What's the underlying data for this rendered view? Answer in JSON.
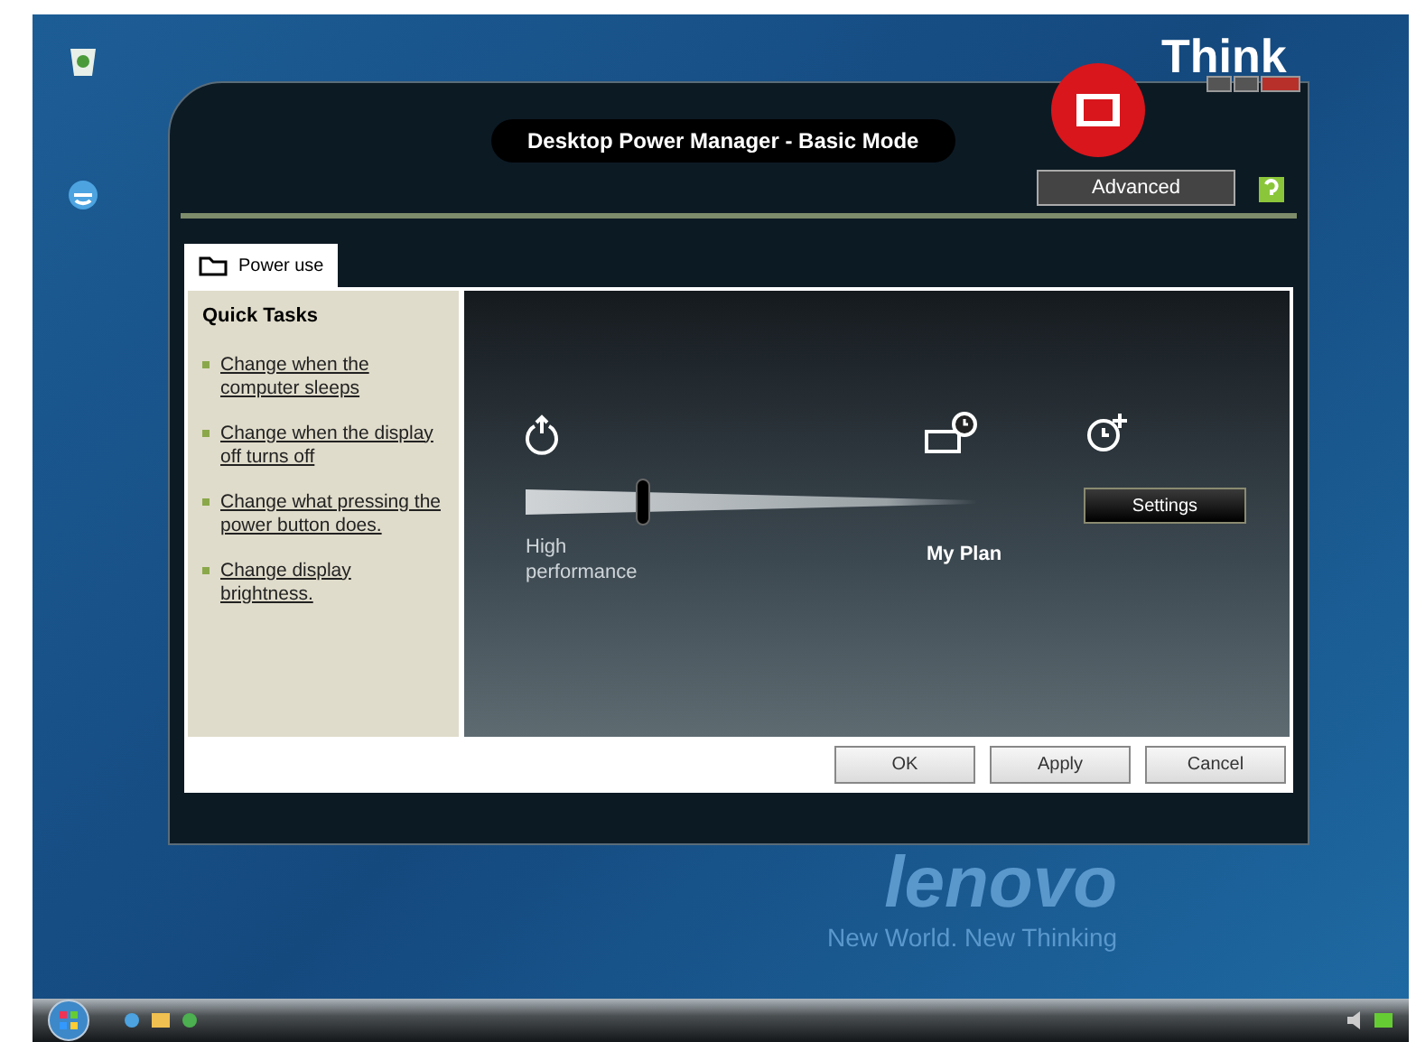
{
  "desktop": {
    "wallpaper_logo": "lenovo",
    "wallpaper_slogan": "New World.  New Thinking",
    "brand_logo": "Think"
  },
  "window": {
    "title": "Desktop Power Manager - Basic Mode",
    "advanced_button": "Advanced"
  },
  "tabs": [
    {
      "label": "Power use",
      "selected": true
    }
  ],
  "quick_tasks": {
    "heading": "Quick Tasks",
    "links": [
      "Change when the computer sleeps",
      "Change when the display off turns off",
      "Change what pressing the power button does.",
      "Change display brightness."
    ]
  },
  "power_slider": {
    "level": 0.26,
    "left_label": "High performance",
    "plan_label": "My Plan",
    "settings_button": "Settings"
  },
  "buttons": [
    "OK",
    "Apply",
    "Cancel"
  ]
}
